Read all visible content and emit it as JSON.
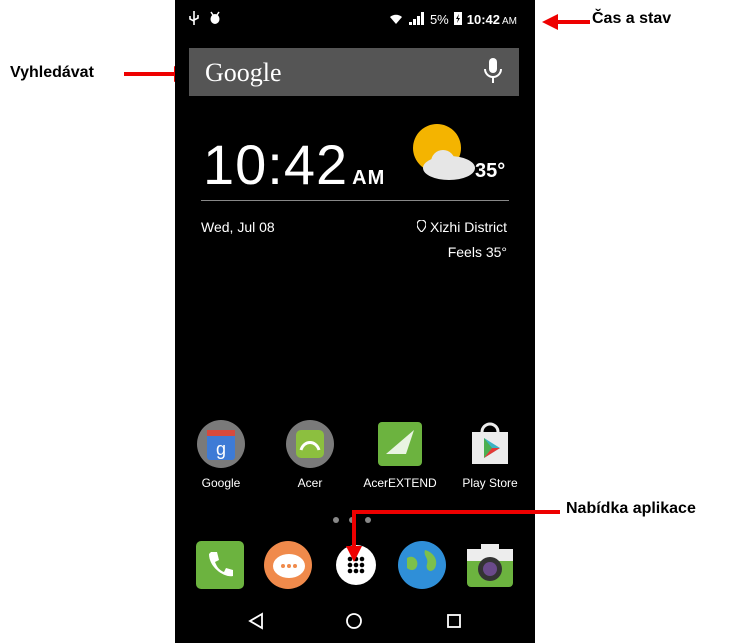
{
  "status_bar": {
    "battery_percent": "5%",
    "time": "10:42",
    "ampm": "AM"
  },
  "search": {
    "logo": "Google"
  },
  "clock": {
    "time": "10:42",
    "ampm": "AM",
    "temperature": "35°",
    "date": "Wed, Jul 08",
    "location": "Xizhi District",
    "feels": "Feels 35°"
  },
  "apps": [
    {
      "label": "Google",
      "icon": "google-folder-icon"
    },
    {
      "label": "Acer",
      "icon": "acer-folder-icon"
    },
    {
      "label": "AcerEXTEND",
      "icon": "acerextend-icon"
    },
    {
      "label": "Play Store",
      "icon": "play-store-icon"
    }
  ],
  "dock": [
    {
      "icon": "phone-icon"
    },
    {
      "icon": "messaging-icon"
    },
    {
      "icon": "app-drawer-icon"
    },
    {
      "icon": "browser-globe-icon"
    },
    {
      "icon": "camera-icon"
    }
  ],
  "annotations": {
    "status": "Čas a stav",
    "search": "Vyhledávat",
    "app_menu": "Nabídka aplikace"
  },
  "colors": {
    "arrow": "#ee0000",
    "screen_bg": "#000000",
    "search_bar": "#555555"
  }
}
